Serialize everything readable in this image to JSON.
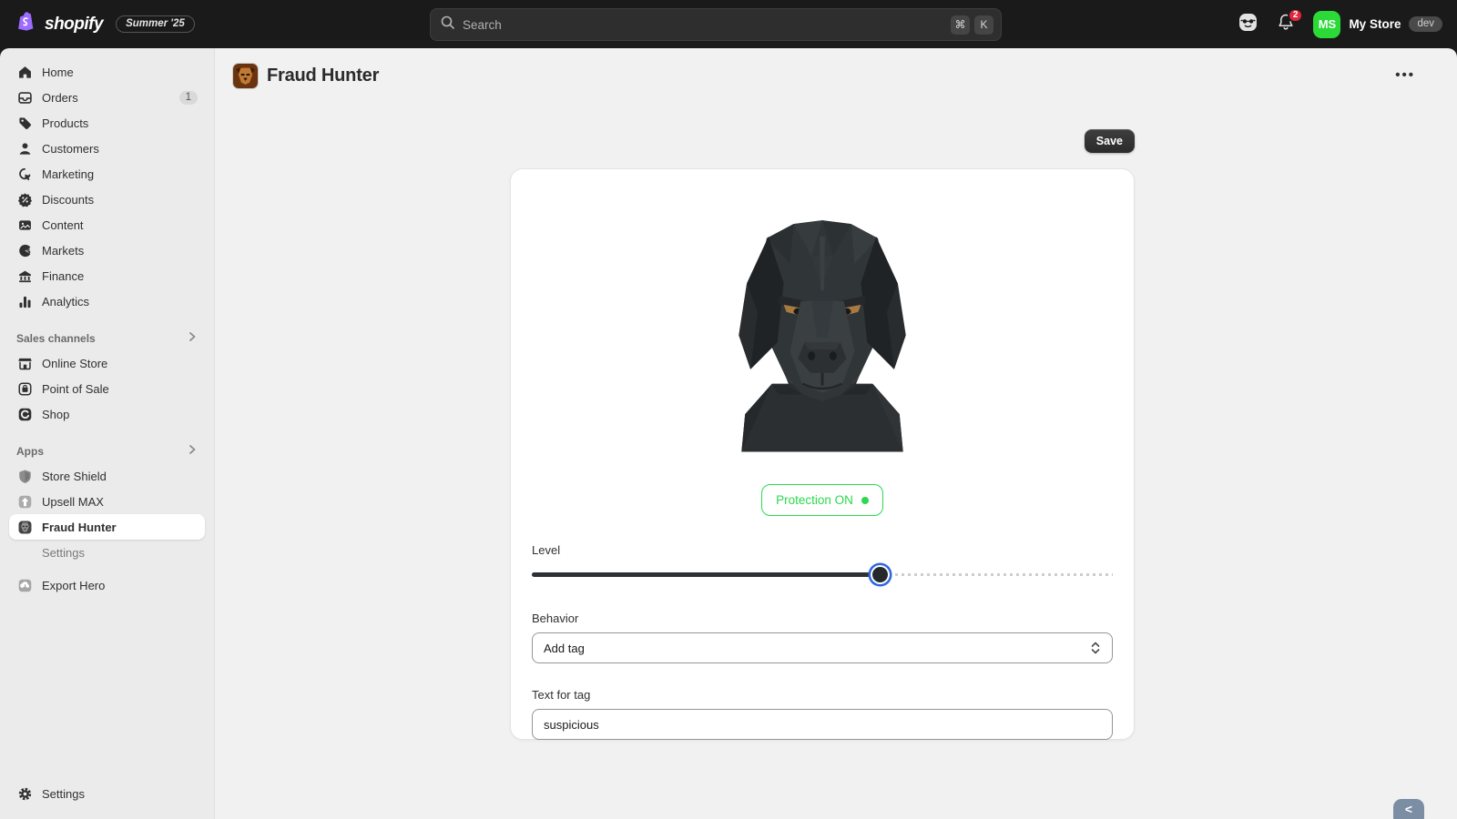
{
  "colors": {
    "topbar_bg": "#1a1a1a",
    "sidebar_bg": "#ebebeb",
    "main_bg": "#f1f1f1",
    "accent_green": "#2bd94c",
    "avatar_green": "#2bd937",
    "notification_red": "#e0263c",
    "focus_blue": "#2f66e0",
    "shopify_purple": "#9d6bff"
  },
  "topbar": {
    "brand": "shopify",
    "version_badge": "Summer '25",
    "search_placeholder": "Search",
    "shortcut_mod": "⌘",
    "shortcut_key": "K",
    "notification_count": "2",
    "avatar_initials": "MS",
    "store_name": "My Store",
    "env_badge": "dev"
  },
  "sidebar": {
    "nav": [
      {
        "label": "Home",
        "icon": "home-icon"
      },
      {
        "label": "Orders",
        "icon": "orders-icon",
        "badge": "1"
      },
      {
        "label": "Products",
        "icon": "products-icon"
      },
      {
        "label": "Customers",
        "icon": "customers-icon"
      },
      {
        "label": "Marketing",
        "icon": "marketing-icon"
      },
      {
        "label": "Discounts",
        "icon": "discounts-icon"
      },
      {
        "label": "Content",
        "icon": "content-icon"
      },
      {
        "label": "Markets",
        "icon": "markets-icon"
      },
      {
        "label": "Finance",
        "icon": "finance-icon"
      },
      {
        "label": "Analytics",
        "icon": "analytics-icon"
      }
    ],
    "sales_channels": {
      "header": "Sales channels",
      "items": [
        {
          "label": "Online Store",
          "icon": "online-store-icon"
        },
        {
          "label": "Point of Sale",
          "icon": "point-of-sale-icon"
        },
        {
          "label": "Shop",
          "icon": "shop-icon"
        }
      ]
    },
    "apps": {
      "header": "Apps",
      "items": [
        {
          "label": "Store Shield",
          "icon": "shield-icon"
        },
        {
          "label": "Upsell MAX",
          "icon": "arrow-up-icon"
        },
        {
          "label": "Fraud Hunter",
          "icon": "dog-icon",
          "selected": true
        },
        {
          "label": "Settings",
          "sub_item_of": "Fraud Hunter"
        },
        {
          "label": "Export Hero",
          "icon": "cloud-download-icon"
        }
      ]
    },
    "footer_settings": "Settings"
  },
  "page": {
    "title": "Fraud Hunter",
    "title_icon": "dog-app-icon",
    "menu_icon": "ellipsis-icon",
    "save_label": "Save"
  },
  "card": {
    "hero_image": "low-poly-black-dog",
    "protection_label": "Protection ON",
    "level_label": "Level",
    "level_percent": 60,
    "behavior_label": "Behavior",
    "behavior_value": "Add tag",
    "tag_label": "Text for tag",
    "tag_value": "suspicious"
  },
  "back_bubble": "<"
}
